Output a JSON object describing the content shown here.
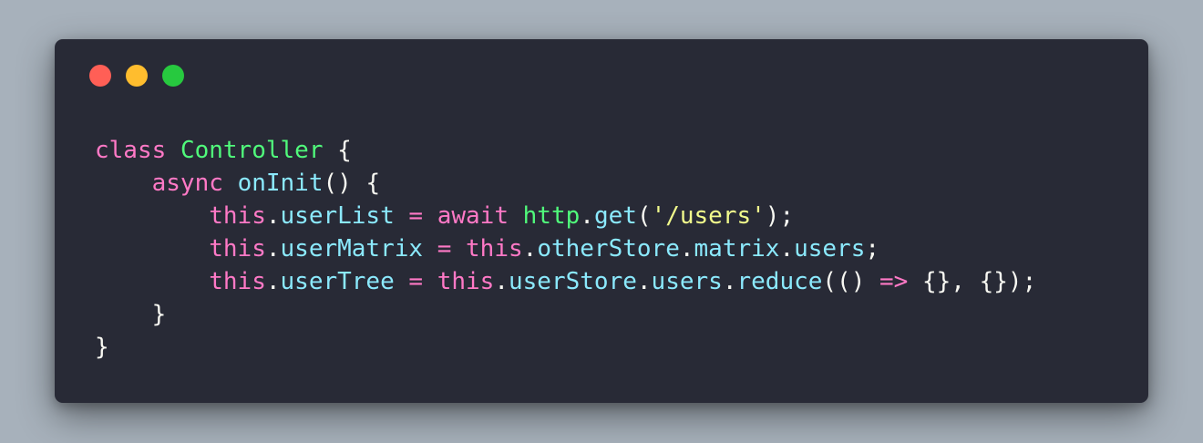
{
  "window": {
    "controls": [
      {
        "name": "close",
        "color": "#ff5f56"
      },
      {
        "name": "minimize",
        "color": "#ffbd2e"
      },
      {
        "name": "maximize",
        "color": "#27c93f"
      }
    ]
  },
  "code": {
    "lines": [
      [
        {
          "t": "class",
          "c": "kw"
        },
        {
          "t": " ",
          "c": "plain"
        },
        {
          "t": "Controller",
          "c": "cls"
        },
        {
          "t": " {",
          "c": "plain"
        }
      ],
      [
        {
          "t": "    ",
          "c": "ind"
        },
        {
          "t": "async",
          "c": "kw"
        },
        {
          "t": " ",
          "c": "plain"
        },
        {
          "t": "onInit",
          "c": "fn"
        },
        {
          "t": "() {",
          "c": "plain"
        }
      ],
      [
        {
          "t": "        ",
          "c": "ind"
        },
        {
          "t": "this",
          "c": "kw"
        },
        {
          "t": ".",
          "c": "plain"
        },
        {
          "t": "userList",
          "c": "prop"
        },
        {
          "t": " ",
          "c": "plain"
        },
        {
          "t": "=",
          "c": "op"
        },
        {
          "t": " ",
          "c": "plain"
        },
        {
          "t": "await",
          "c": "kw"
        },
        {
          "t": " ",
          "c": "plain"
        },
        {
          "t": "http",
          "c": "cls"
        },
        {
          "t": ".",
          "c": "plain"
        },
        {
          "t": "get",
          "c": "fn"
        },
        {
          "t": "(",
          "c": "plain"
        },
        {
          "t": "'/users'",
          "c": "str"
        },
        {
          "t": ");",
          "c": "plain"
        }
      ],
      [
        {
          "t": "        ",
          "c": "ind"
        },
        {
          "t": "this",
          "c": "kw"
        },
        {
          "t": ".",
          "c": "plain"
        },
        {
          "t": "userMatrix",
          "c": "prop"
        },
        {
          "t": " ",
          "c": "plain"
        },
        {
          "t": "=",
          "c": "op"
        },
        {
          "t": " ",
          "c": "plain"
        },
        {
          "t": "this",
          "c": "kw"
        },
        {
          "t": ".",
          "c": "plain"
        },
        {
          "t": "otherStore",
          "c": "prop"
        },
        {
          "t": ".",
          "c": "plain"
        },
        {
          "t": "matrix",
          "c": "prop"
        },
        {
          "t": ".",
          "c": "plain"
        },
        {
          "t": "users",
          "c": "prop"
        },
        {
          "t": ";",
          "c": "plain"
        }
      ],
      [
        {
          "t": "        ",
          "c": "ind"
        },
        {
          "t": "this",
          "c": "kw"
        },
        {
          "t": ".",
          "c": "plain"
        },
        {
          "t": "userTree",
          "c": "prop"
        },
        {
          "t": " ",
          "c": "plain"
        },
        {
          "t": "=",
          "c": "op"
        },
        {
          "t": " ",
          "c": "plain"
        },
        {
          "t": "this",
          "c": "kw"
        },
        {
          "t": ".",
          "c": "plain"
        },
        {
          "t": "userStore",
          "c": "prop"
        },
        {
          "t": ".",
          "c": "plain"
        },
        {
          "t": "users",
          "c": "prop"
        },
        {
          "t": ".",
          "c": "plain"
        },
        {
          "t": "reduce",
          "c": "fn"
        },
        {
          "t": "(() ",
          "c": "plain"
        },
        {
          "t": "=>",
          "c": "op"
        },
        {
          "t": " {}, {});",
          "c": "plain"
        }
      ],
      [
        {
          "t": "    ",
          "c": "ind"
        },
        {
          "t": "}",
          "c": "plain"
        }
      ],
      [
        {
          "t": "}",
          "c": "plain"
        }
      ]
    ]
  }
}
